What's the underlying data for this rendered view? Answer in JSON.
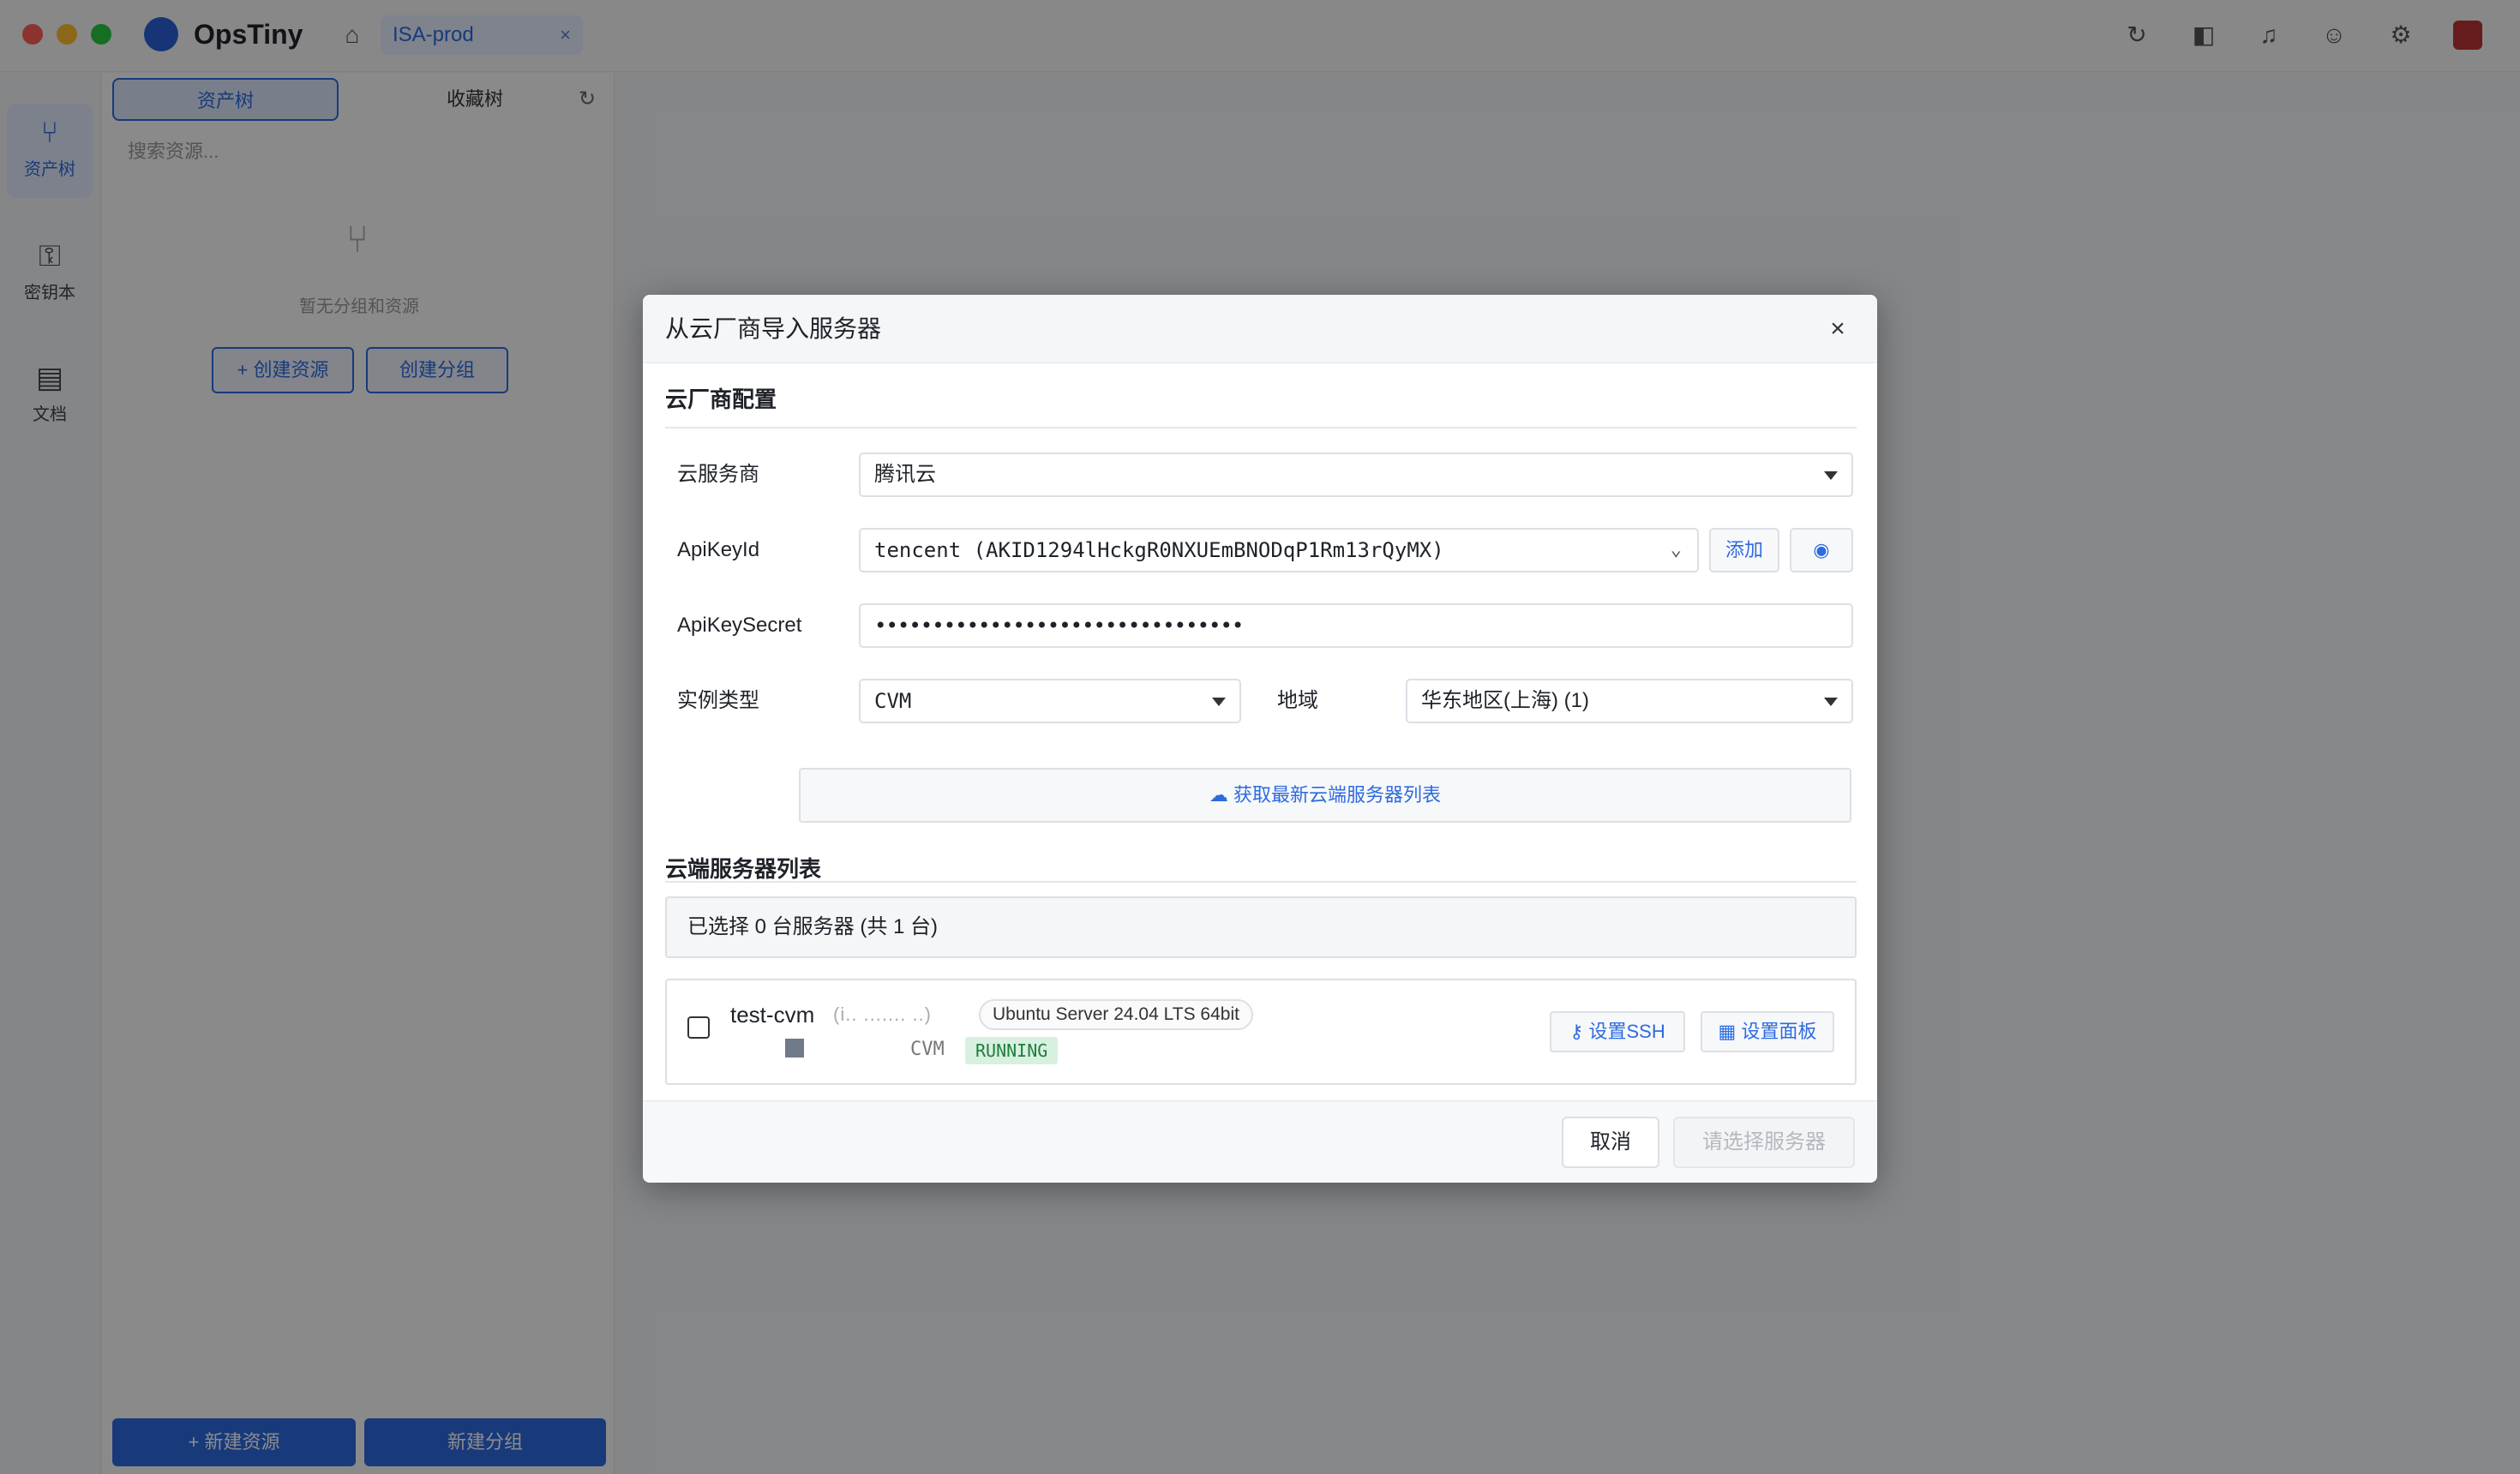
{
  "app": {
    "name": "OpsTiny",
    "workspace_tab": "ISA-prod",
    "workspace_tab_close": "×"
  },
  "rail": {
    "items": [
      {
        "label": "资产树",
        "icon": "tree-icon"
      },
      {
        "label": "密钥本",
        "icon": "key-icon"
      },
      {
        "label": "文档",
        "icon": "document-icon"
      }
    ]
  },
  "panel": {
    "tab_assets": "资产树",
    "tab_other": "收藏树",
    "search_placeholder": "搜索资源...",
    "empty_text": "暂无分组和资源",
    "btn_new_resource": "+ 创建资源",
    "btn_new_group": "创建分组",
    "bottom_new_resource": "+ 新建资源",
    "bottom_new_group": "新建分组"
  },
  "modal": {
    "title": "从云厂商导入服务器",
    "close": "×",
    "section_config": "云厂商配置",
    "provider_label": "云服务商",
    "provider_value": "腾讯云",
    "apikeyid_label": "ApiKeyId",
    "apikeyid_value": "tencent (AKID1294lHckgR0NXUEmBNODqP1Rm13rQyMX)",
    "add_button": "添加",
    "apikeysecret_label": "ApiKeySecret",
    "apikeysecret_value": "••••••••••••••••••••••••••••••••",
    "instance_type_label": "实例类型",
    "instance_type_value": "CVM",
    "region_label": "地域",
    "region_value": "华东地区(上海) (1)",
    "fetch_button": "获取最新云端服务器列表",
    "section_list": "云端服务器列表",
    "selection_summary": "已选择 0 台服务器 (共 1 台)",
    "servers": [
      {
        "name": "test-cvm",
        "ip": "(i.. ....... ..)",
        "os": "Ubuntu Server 24.04 LTS 64bit",
        "type": "CVM",
        "status": "RUNNING",
        "ssh_button": "设置SSH",
        "panel_button": "设置面板"
      }
    ],
    "cancel_button": "取消",
    "confirm_button": "请选择服务器"
  },
  "colors": {
    "accent": "#2d6be0",
    "status_running_bg": "#d7f0df",
    "status_running_text": "#1e7d3c"
  }
}
